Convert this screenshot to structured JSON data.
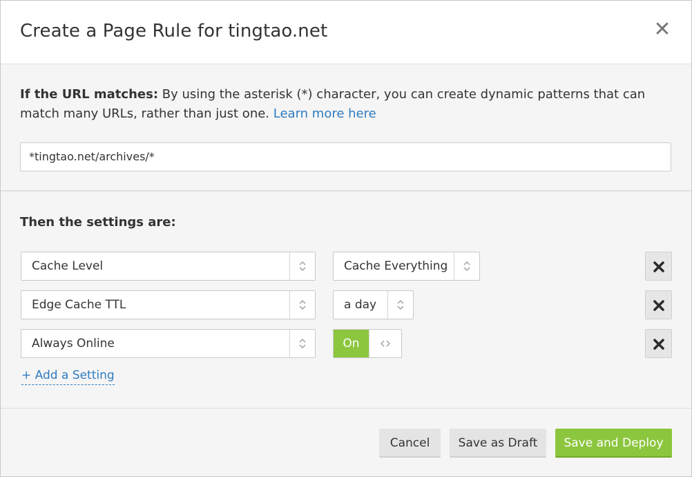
{
  "dialog": {
    "title": "Create a Page Rule for tingtao.net",
    "close_glyph": "✕"
  },
  "url_section": {
    "label_bold": "If the URL matches:",
    "description": " By using the asterisk (*) character, you can create dynamic patterns that can match many URLs, rather than just one. ",
    "learn_more": "Learn more here",
    "url_value": "*tingtao.net/archives/*"
  },
  "settings_section": {
    "title": "Then the settings are:",
    "rows": [
      {
        "setting": "Cache Level",
        "value": "Cache Everything",
        "control": "select"
      },
      {
        "setting": "Edge Cache TTL",
        "value": "a day",
        "control": "select"
      },
      {
        "setting": "Always Online",
        "value": "On",
        "control": "toggle"
      }
    ],
    "add_setting": "+ Add a Setting"
  },
  "footer": {
    "cancel": "Cancel",
    "save_draft": "Save as Draft",
    "save_deploy": "Save and Deploy"
  },
  "colors": {
    "accent_green": "#8cc63f",
    "link_blue": "#2f7bbf"
  },
  "icons": [
    "close-icon",
    "select-arrows-icon",
    "toggle-arrows-icon",
    "remove-icon"
  ]
}
